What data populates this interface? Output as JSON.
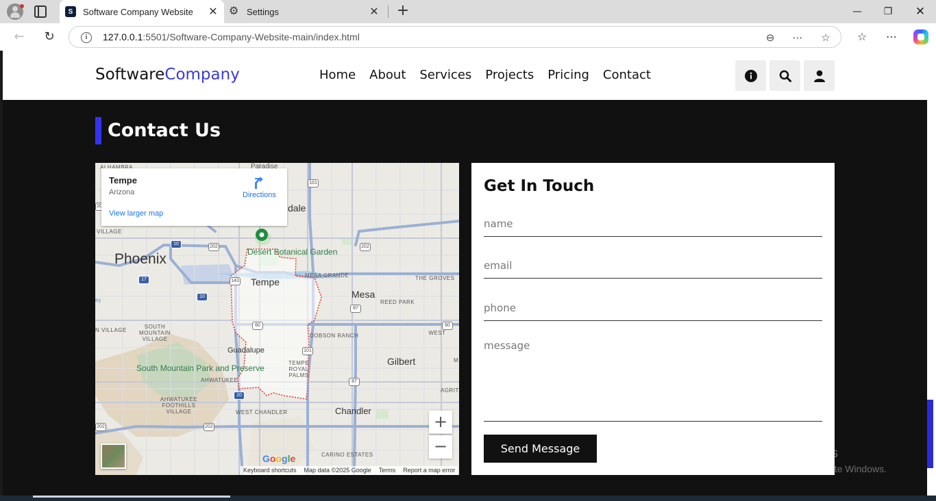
{
  "browser": {
    "tabs": [
      {
        "title": "Software Company Website",
        "favicon": "site-logo-icon",
        "active": true
      },
      {
        "title": "Settings",
        "favicon": "gear-icon",
        "active": false
      }
    ],
    "url_host": "127.0.0.1",
    "url_rest": ":5501/Software-Company-Website-main/index.html"
  },
  "site": {
    "logo_main": "Software",
    "logo_accent": "Company",
    "accent_color": "#3a3adb",
    "nav": [
      "Home",
      "About",
      "Services",
      "Projects",
      "Pricing",
      "Contact"
    ],
    "header_icons": [
      "info-icon",
      "search-icon",
      "user-icon"
    ]
  },
  "contact": {
    "heading": "Contact Us",
    "map": {
      "place": "Tempe",
      "region": "Arizona",
      "directions": "Directions",
      "larger_map": "View larger map",
      "labels": {
        "phoenix": "Phoenix",
        "tempe": "Tempe",
        "mesa": "Mesa",
        "gilbert": "Gilbert",
        "chandler": "Chandler",
        "guadalupe": "Guadalupe",
        "dale": "dale",
        "paradise": "Paradise",
        "alhambra": "ALHAMBRA",
        "village": "VILLAGE",
        "mesa_grande": "MESA GRANDE",
        "the_groves": "THE GROVES",
        "reed_park": "REED PARK",
        "dobson_ranch": "DOBSON RANCH",
        "west_valley": "WEST",
        "south_mountain_village": "SOUTH MOUNTAIN VILLAGE",
        "n_village": "N VILLAGE",
        "tempe_royal_palms": "TEMPE ROYAL PALMS",
        "ahwatukee": "AHWATUKEE",
        "ahwatukee_foothills": "AHWATUKEE FOOTHILLS VILLAGE",
        "west_chandler": "WEST CHANDLER",
        "carino_estates": "CARINO ESTATES",
        "desert_botanical": "Desert Botanical Garden",
        "south_mountain_park": "South Mountain Park and Preserve",
        "ey": "ey",
        "agrit": "AGRIT",
        "m": "M"
      },
      "highways": [
        "101",
        "202",
        "10",
        "17",
        "143",
        "10",
        "60",
        "87",
        "87",
        "101",
        "10",
        "87",
        "202",
        "202",
        "60",
        "20",
        "202",
        "34",
        "202"
      ],
      "google": "Google",
      "attribution": [
        "Keyboard shortcuts",
        "Map data ©2025 Google",
        "Terms",
        "Report a map error"
      ],
      "zoom_in": "+",
      "zoom_out": "−"
    },
    "form": {
      "title": "Get In Touch",
      "name_placeholder": "name",
      "email_placeholder": "email",
      "phone_placeholder": "phone",
      "message_placeholder": "message",
      "submit": "Send Message"
    }
  },
  "watermark": {
    "line1": "Activate Windows",
    "line2": "Go to Settings to activate Windows."
  }
}
